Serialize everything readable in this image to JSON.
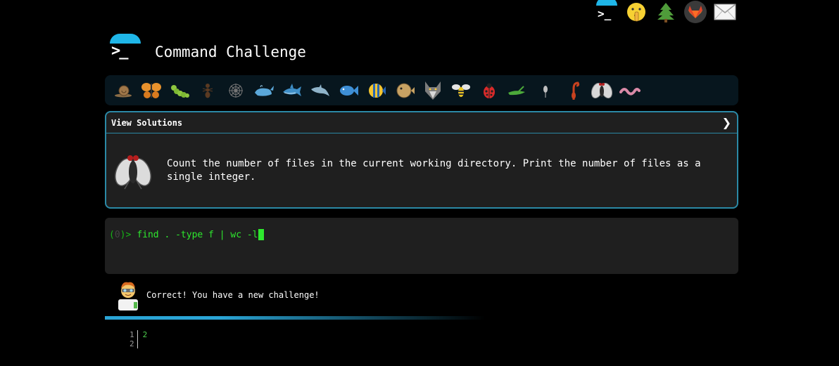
{
  "topbar": {
    "icons": [
      "terminal-icon",
      "shushing-face-icon",
      "evergreen-tree-icon",
      "gitlab-icon",
      "envelope-icon"
    ]
  },
  "header": {
    "title": "Command Challenge"
  },
  "creatures": [
    "snail-icon",
    "butterfly-icon",
    "caterpillar-icon",
    "ant-icon",
    "spider-web-icon",
    "whale-icon",
    "shark-icon",
    "dolphin-icon",
    "fish-icon",
    "tropical-fish-icon",
    "blowfish-icon",
    "wolf-icon",
    "bee-icon",
    "ladybug-icon",
    "cricket-icon",
    "mosquito-icon",
    "scorpion-icon",
    "fly-icon",
    "worm-icon"
  ],
  "challenge": {
    "header_label": "View Solutions",
    "text": "Count the number of files in the current working directory. Print the number of files as a single integer."
  },
  "terminal": {
    "prompt_open": "(",
    "prompt_num": "0",
    "prompt_close": ")>",
    "command": "find . -type f | wc -l"
  },
  "result": {
    "message": "Correct! You have a new challenge!"
  },
  "output": {
    "line_numbers": [
      "1",
      "2"
    ],
    "lines": [
      "2",
      ""
    ]
  },
  "colors": {
    "accent": "#2b89a6",
    "terminal_green": "#2ee82e",
    "panel_bg": "#1f1f1f"
  }
}
